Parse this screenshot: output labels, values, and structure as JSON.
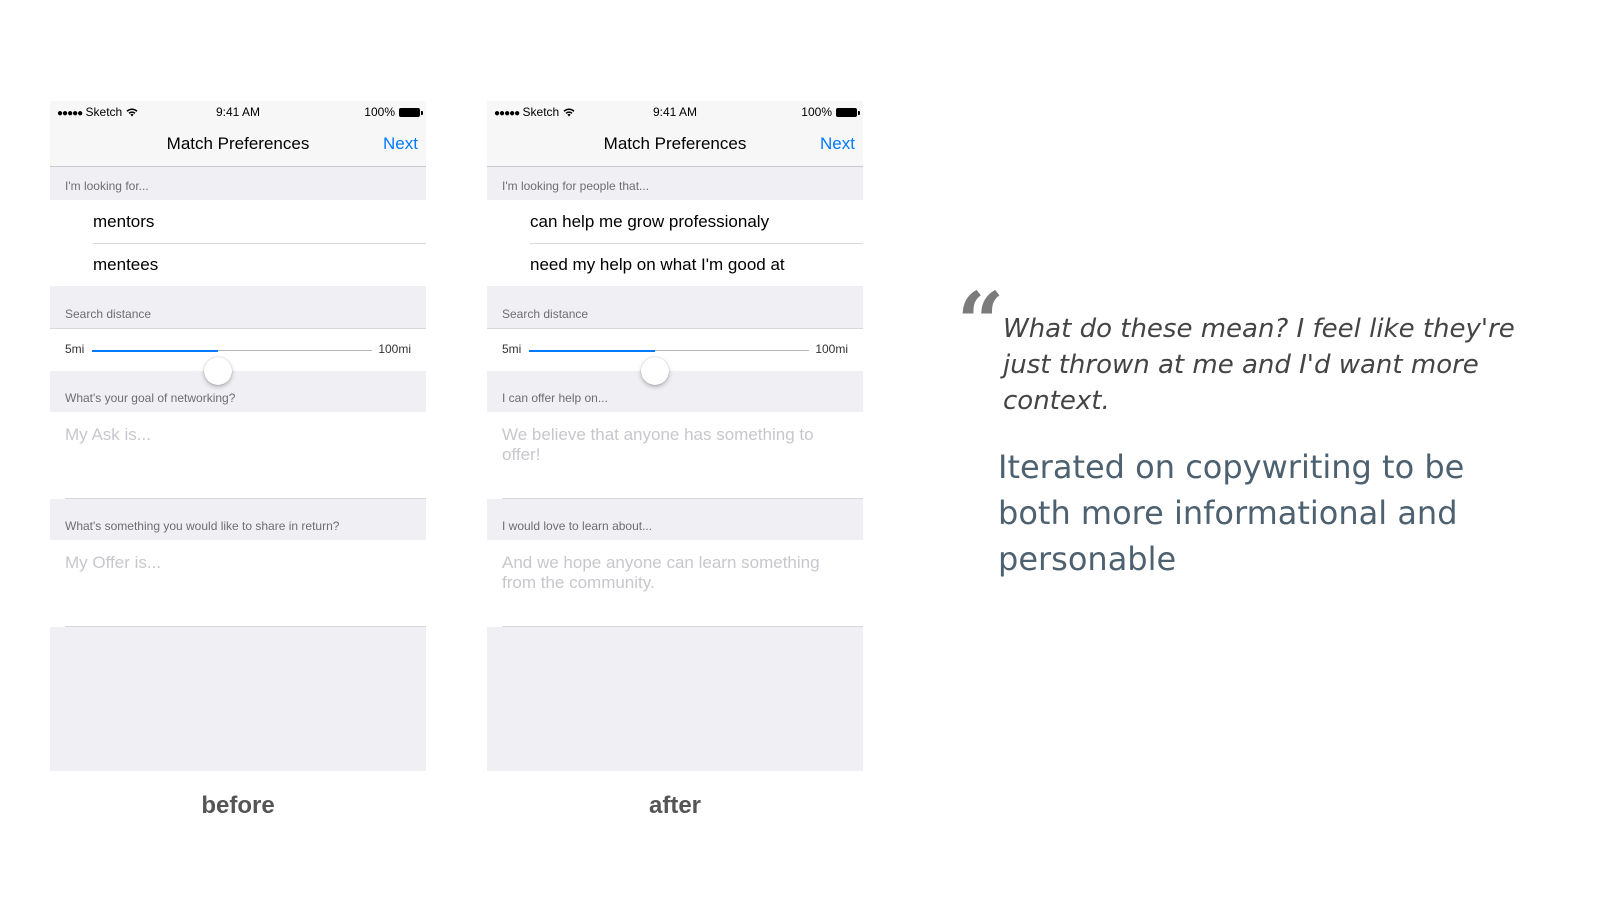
{
  "status_bar": {
    "carrier": "Sketch",
    "time": "9:41 AM",
    "battery": "100%",
    "signal_dots": "●●●●●"
  },
  "before": {
    "nav_title": "Match Preferences",
    "nav_next": "Next",
    "looking_label": "I'm looking for...",
    "option_1": "mentors",
    "option_2": "mentees",
    "distance_label": "Search distance",
    "distance_min": "5mi",
    "distance_max": "100mi",
    "distance_value": 0.45,
    "goal_label": "What's your goal of networking?",
    "goal_placeholder": "My Ask is...",
    "share_label": "What's something you would like to share in return?",
    "share_placeholder": "My Offer is...",
    "caption": "before"
  },
  "after": {
    "nav_title": "Match Preferences",
    "nav_next": "Next",
    "looking_label": "I'm looking for people that...",
    "option_1": "can help me grow professionaly",
    "option_2": "need my help on what I'm good at",
    "distance_label": "Search distance",
    "distance_min": "5mi",
    "distance_max": "100mi",
    "distance_value": 0.45,
    "goal_label": "I can offer help on...",
    "goal_placeholder": "We believe that anyone has something to offer!",
    "share_label": "I would love to learn about...",
    "share_placeholder": "And we hope anyone can learn something from the community.",
    "caption": "after"
  },
  "quote": {
    "mark": "“",
    "text": "What do these mean? I feel like they're just thrown at me and I'd want more context."
  },
  "summary": "Iterated on copywriting to be both more informational and personable",
  "colors": {
    "accent": "#007aff",
    "grouped_bg": "#efeff4",
    "summary_text": "#4d6170"
  }
}
